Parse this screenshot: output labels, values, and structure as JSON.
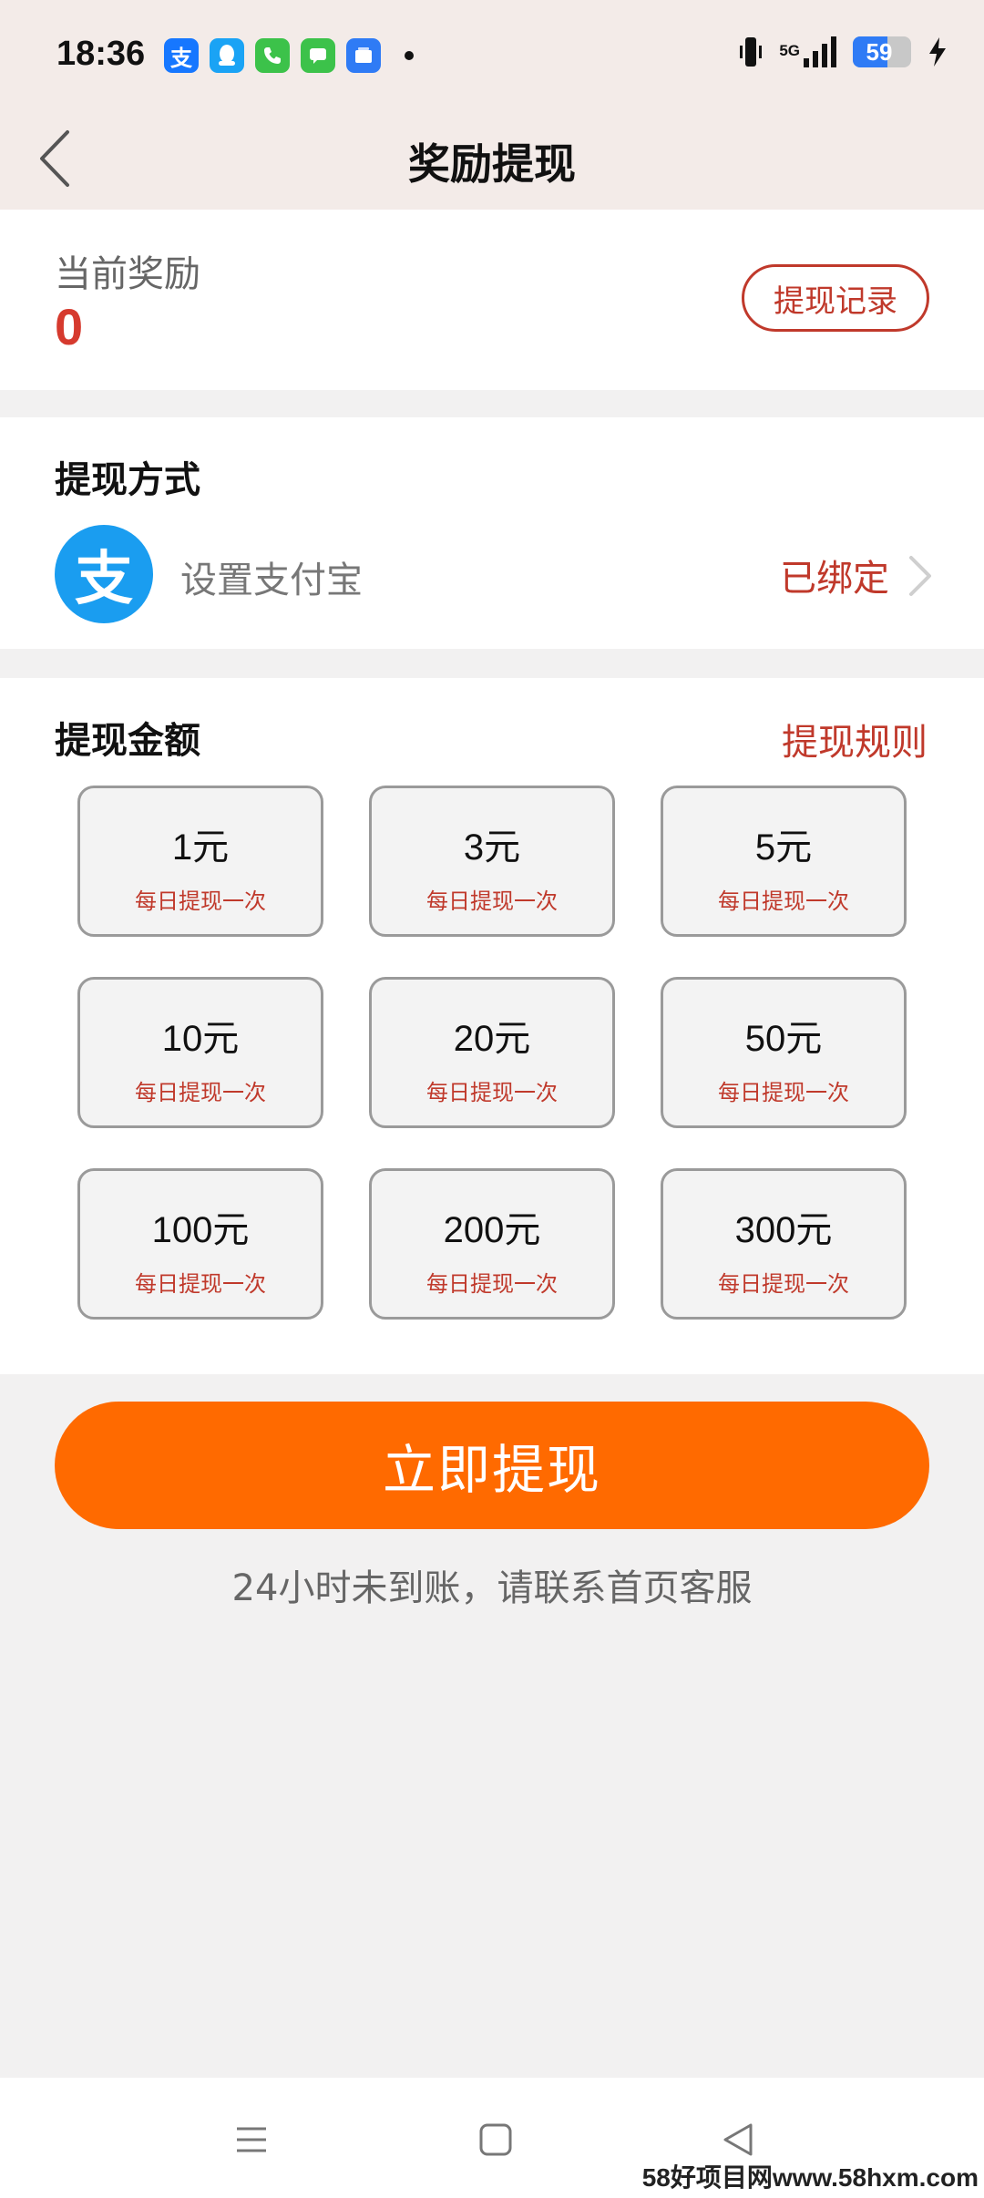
{
  "status_bar": {
    "time": "18:36",
    "apps": [
      {
        "name": "alipay-app-icon",
        "glyph": "支",
        "color": "#1677ff"
      },
      {
        "name": "qq-app-icon",
        "glyph": "",
        "color": "#1aa3f5"
      },
      {
        "name": "phone-app-icon",
        "glyph": "",
        "color": "#3cc24a"
      },
      {
        "name": "messages-app-icon",
        "glyph": "",
        "color": "#3cc24a"
      },
      {
        "name": "files-app-icon",
        "glyph": "",
        "color": "#2f7bf5"
      }
    ],
    "network": "5G",
    "battery": "59",
    "battery_level": 0.59
  },
  "header": {
    "title": "奖励提现"
  },
  "reward": {
    "label": "当前奖励",
    "value": "0",
    "history_button": "提现记录"
  },
  "method": {
    "title": "提现方式",
    "logo_glyph": "支",
    "option_label": "设置支付宝",
    "status": "已绑定"
  },
  "amount": {
    "title": "提现金额",
    "rules_link": "提现规则",
    "options": [
      {
        "value": "1元",
        "note": "每日提现一次"
      },
      {
        "value": "3元",
        "note": "每日提现一次"
      },
      {
        "value": "5元",
        "note": "每日提现一次"
      },
      {
        "value": "10元",
        "note": "每日提现一次"
      },
      {
        "value": "20元",
        "note": "每日提现一次"
      },
      {
        "value": "50元",
        "note": "每日提现一次"
      },
      {
        "value": "100元",
        "note": "每日提现一次"
      },
      {
        "value": "200元",
        "note": "每日提现一次"
      },
      {
        "value": "300元",
        "note": "每日提现一次"
      }
    ]
  },
  "actions": {
    "withdraw_button": "立即提现",
    "hint": "24小时未到账，请联系首页客服"
  },
  "watermark": "58好项目网www.58hxm.com",
  "colors": {
    "accent_red": "#c0392b",
    "reward_red": "#d63a2e",
    "primary_orange": "#ff6a00",
    "alipay_blue": "#1a9df0"
  }
}
